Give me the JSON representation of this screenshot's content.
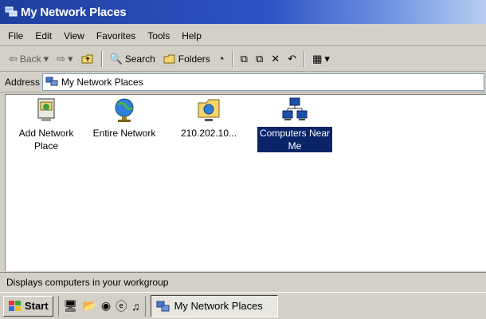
{
  "window": {
    "title": "My Network Places"
  },
  "menu": [
    "File",
    "Edit",
    "View",
    "Favorites",
    "Tools",
    "Help"
  ],
  "toolbar": {
    "back": "Back",
    "search": "Search",
    "folders": "Folders"
  },
  "address": {
    "label": "Address",
    "value": "My Network Places"
  },
  "items": [
    {
      "label": "Add Network Place",
      "icon": "add-network-place-icon"
    },
    {
      "label": "Entire Network",
      "icon": "globe-icon"
    },
    {
      "label": "210.202.10...",
      "icon": "network-folder-icon"
    },
    {
      "label": "Computers Near Me",
      "icon": "computers-icon"
    }
  ],
  "status": {
    "text": "Displays computers in your workgroup"
  },
  "taskbar": {
    "start_label": "Start",
    "task_label": "My Network Places"
  },
  "colors": {
    "title_start": "#1f3f9e",
    "selection": "#0a246a"
  }
}
